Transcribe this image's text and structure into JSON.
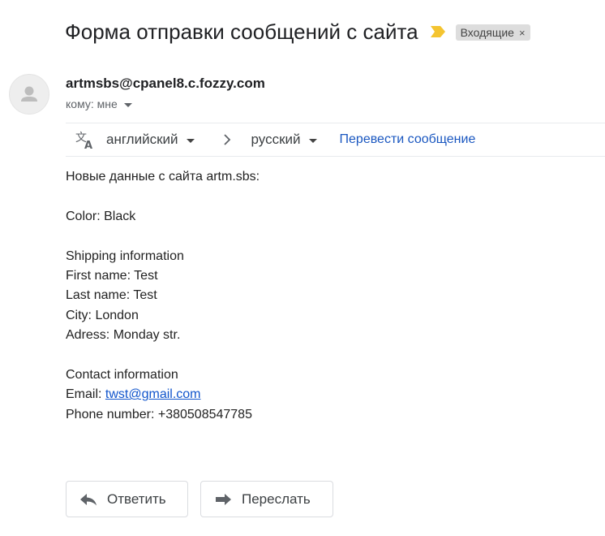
{
  "email": {
    "subject": "Форма отправки сообщений с сайта",
    "label": "Входящие",
    "label_remove": "×",
    "importance_icon": "importance-marker-icon",
    "importance_color": "#f4c430",
    "sender": "artmsbs@cpanel8.c.fozzy.com",
    "to_text": "кому: мне"
  },
  "translate_bar": {
    "icon": "translate-icon",
    "source_lang": "английский",
    "target_lang": "русский",
    "translate_link": "Перевести сообщение",
    "link_color": "#1a57c0"
  },
  "body": {
    "intro": "Новые данные с сайта artm.sbs:",
    "color": "Color: Black",
    "shipping_header": "Shipping information",
    "first_name": "First name: Test",
    "last_name": "Last name: Test",
    "city": "City: London",
    "address": "Adress: Monday str.",
    "contact_header": "Contact information",
    "email_label": "Email: ",
    "email_link": "twst@gmail.com",
    "phone": "Phone number: +380508547785"
  },
  "actions": {
    "reply_label": "Ответить",
    "forward_label": "Переслать"
  }
}
